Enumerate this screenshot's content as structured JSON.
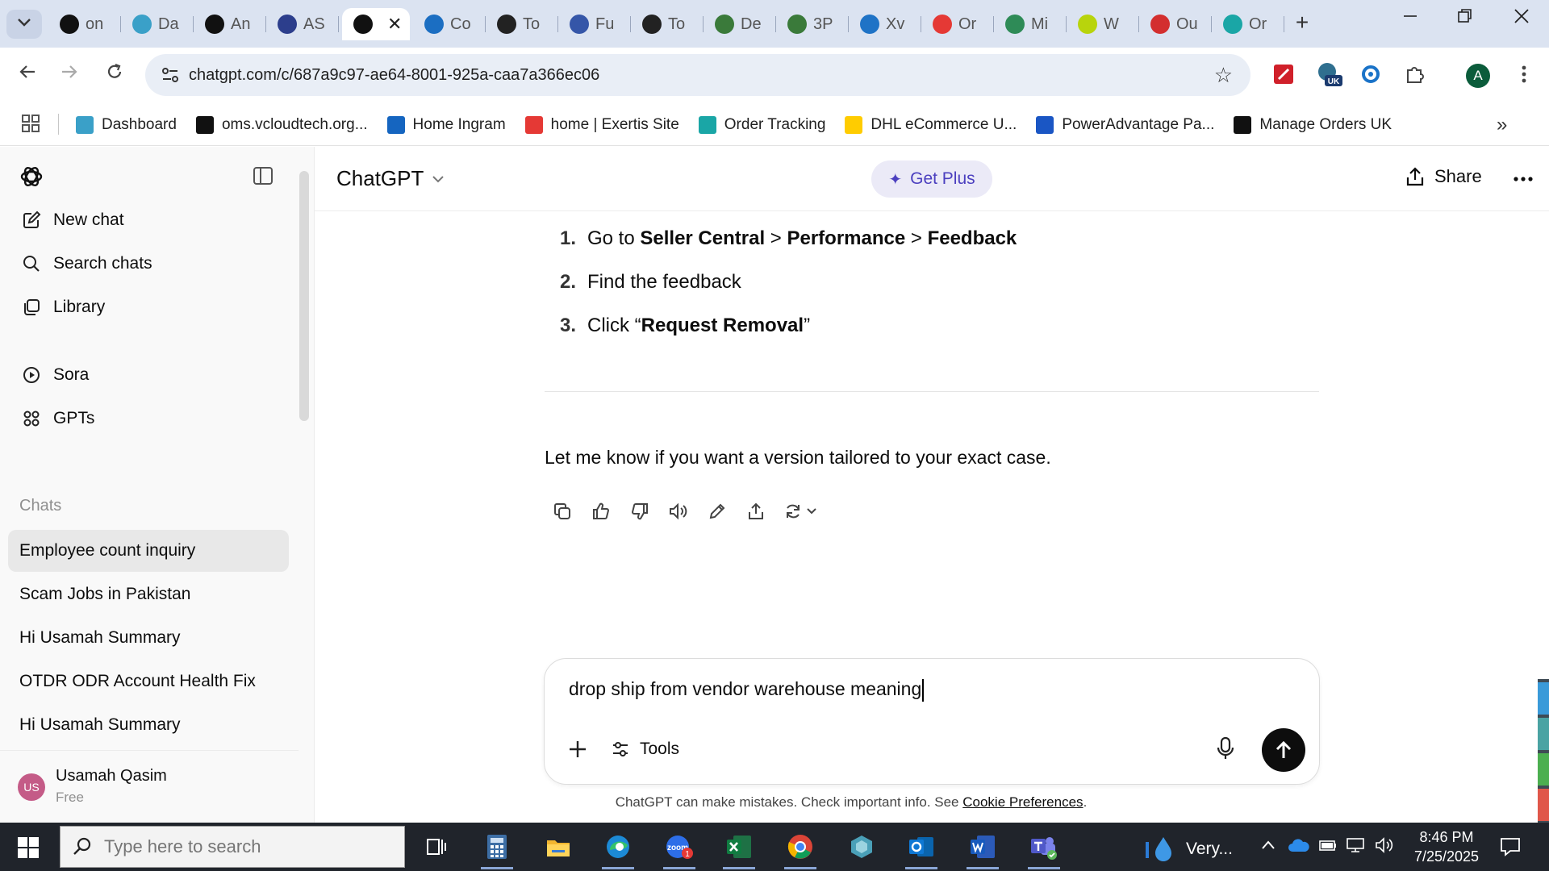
{
  "browser": {
    "tabs": [
      {
        "title": "on",
        "icon": "openai-dark-icon",
        "color": "#111111"
      },
      {
        "title": "Da",
        "icon": "hexagon-icon",
        "color": "#3aa0c8"
      },
      {
        "title": "An",
        "icon": "amazon-icon",
        "color": "#111111"
      },
      {
        "title": "AS",
        "icon": "play-arrow-icon",
        "color": "#2c3e8c"
      },
      {
        "title": "",
        "icon": "chatgpt-icon",
        "color": "#111111",
        "active": true
      },
      {
        "title": "Co",
        "icon": "c-logo-icon",
        "color": "#1b6ec2"
      },
      {
        "title": "To",
        "icon": "c-logo-icon",
        "color": "#222222"
      },
      {
        "title": "Fu",
        "icon": "cube-icon",
        "color": "#3556a8"
      },
      {
        "title": "To",
        "icon": "c-logo-icon",
        "color": "#222222"
      },
      {
        "title": "De",
        "icon": "spreadsheet-icon",
        "color": "#3a7a3a"
      },
      {
        "title": "3P",
        "icon": "spreadsheet-icon",
        "color": "#3a7a3a"
      },
      {
        "title": "Xv",
        "icon": "arrow-up-icon",
        "color": "#1f73c6"
      },
      {
        "title": "Or",
        "icon": "exertis-icon",
        "color": "#e53935"
      },
      {
        "title": "Mi",
        "icon": "leaf-circle-icon",
        "color": "#2e8b57"
      },
      {
        "title": "W",
        "icon": "infos-icon",
        "color": "#b8d40c"
      },
      {
        "title": "Ou",
        "icon": "shwe-icon",
        "color": "#d32f2f"
      },
      {
        "title": "Or",
        "icon": "c-logo-icon",
        "color": "#1aa6a6"
      }
    ],
    "tab_close": "✕",
    "new_tab": "+",
    "url": "chatgpt.com/c/687a9c97-ae64-8001-925a-caa7a366ec06",
    "profile_initial": "A",
    "bookmarks": [
      {
        "label": "Dashboard",
        "icon": "hexagon-icon",
        "color": "#3aa0c8"
      },
      {
        "label": "oms.vcloudtech.org...",
        "icon": "triangle-icon",
        "color": "#111111"
      },
      {
        "label": "Home Ingram",
        "icon": "ingram-icon",
        "color": "#1565c0"
      },
      {
        "label": "home | Exertis Site",
        "icon": "exertis-icon",
        "color": "#e53935"
      },
      {
        "label": "Order Tracking",
        "icon": "c-logo-icon",
        "color": "#1aa6a6"
      },
      {
        "label": "DHL eCommerce U...",
        "icon": "dhl-icon",
        "color": "#ffcc00"
      },
      {
        "label": "PowerAdvantage Pa...",
        "icon": "doc-icon",
        "color": "#1a56c4"
      },
      {
        "label": "Manage Orders UK",
        "icon": "amazon-icon",
        "color": "#111111"
      }
    ]
  },
  "sidebar": {
    "nav": [
      {
        "label": "New chat",
        "icon": "edit-icon"
      },
      {
        "label": "Search chats",
        "icon": "search-icon"
      },
      {
        "label": "Library",
        "icon": "library-icon"
      },
      {
        "label": "Sora",
        "icon": "play-circle-icon"
      },
      {
        "label": "GPTs",
        "icon": "grid-icon"
      }
    ],
    "chats_heading": "Chats",
    "chats": [
      {
        "title": "Employee count inquiry",
        "active": true
      },
      {
        "title": "Scam Jobs in Pakistan"
      },
      {
        "title": "Hi Usamah Summary"
      },
      {
        "title": "OTDR ODR Account Health Fix"
      },
      {
        "title": "Hi Usamah Summary"
      }
    ],
    "user": {
      "initials": "US",
      "name": "Usamah Qasim",
      "plan": "Free"
    }
  },
  "header": {
    "model": "ChatGPT",
    "get_plus": "Get Plus",
    "share": "Share"
  },
  "conversation": {
    "steps": [
      {
        "num": "1.",
        "parts": [
          {
            "text": "Go to ",
            "bold": false
          },
          {
            "text": "Seller Central",
            "bold": true
          },
          {
            "text": " > ",
            "bold": false
          },
          {
            "text": "Performance",
            "bold": true
          },
          {
            "text": " > ",
            "bold": false
          },
          {
            "text": "Feedback",
            "bold": true
          }
        ]
      },
      {
        "num": "2.",
        "parts": [
          {
            "text": "Find the feedback",
            "bold": false
          }
        ]
      },
      {
        "num": "3.",
        "parts": [
          {
            "text": "Click “",
            "bold": false
          },
          {
            "text": "Request Removal",
            "bold": true
          },
          {
            "text": "”",
            "bold": false
          }
        ]
      }
    ],
    "closing": "Let me know if you want a version tailored to your exact case."
  },
  "composer": {
    "value": "drop ship from vendor warehouse meaning",
    "tools_label": "Tools"
  },
  "disclaimer": {
    "text": "ChatGPT can make mistakes. Check important info. See ",
    "link": "Cookie Preferences",
    "end": "."
  },
  "taskbar": {
    "search_placeholder": "Type here to search",
    "weather": "Very...",
    "time": "8:46 PM",
    "date": "7/25/2025",
    "zoom_badge": "1"
  }
}
